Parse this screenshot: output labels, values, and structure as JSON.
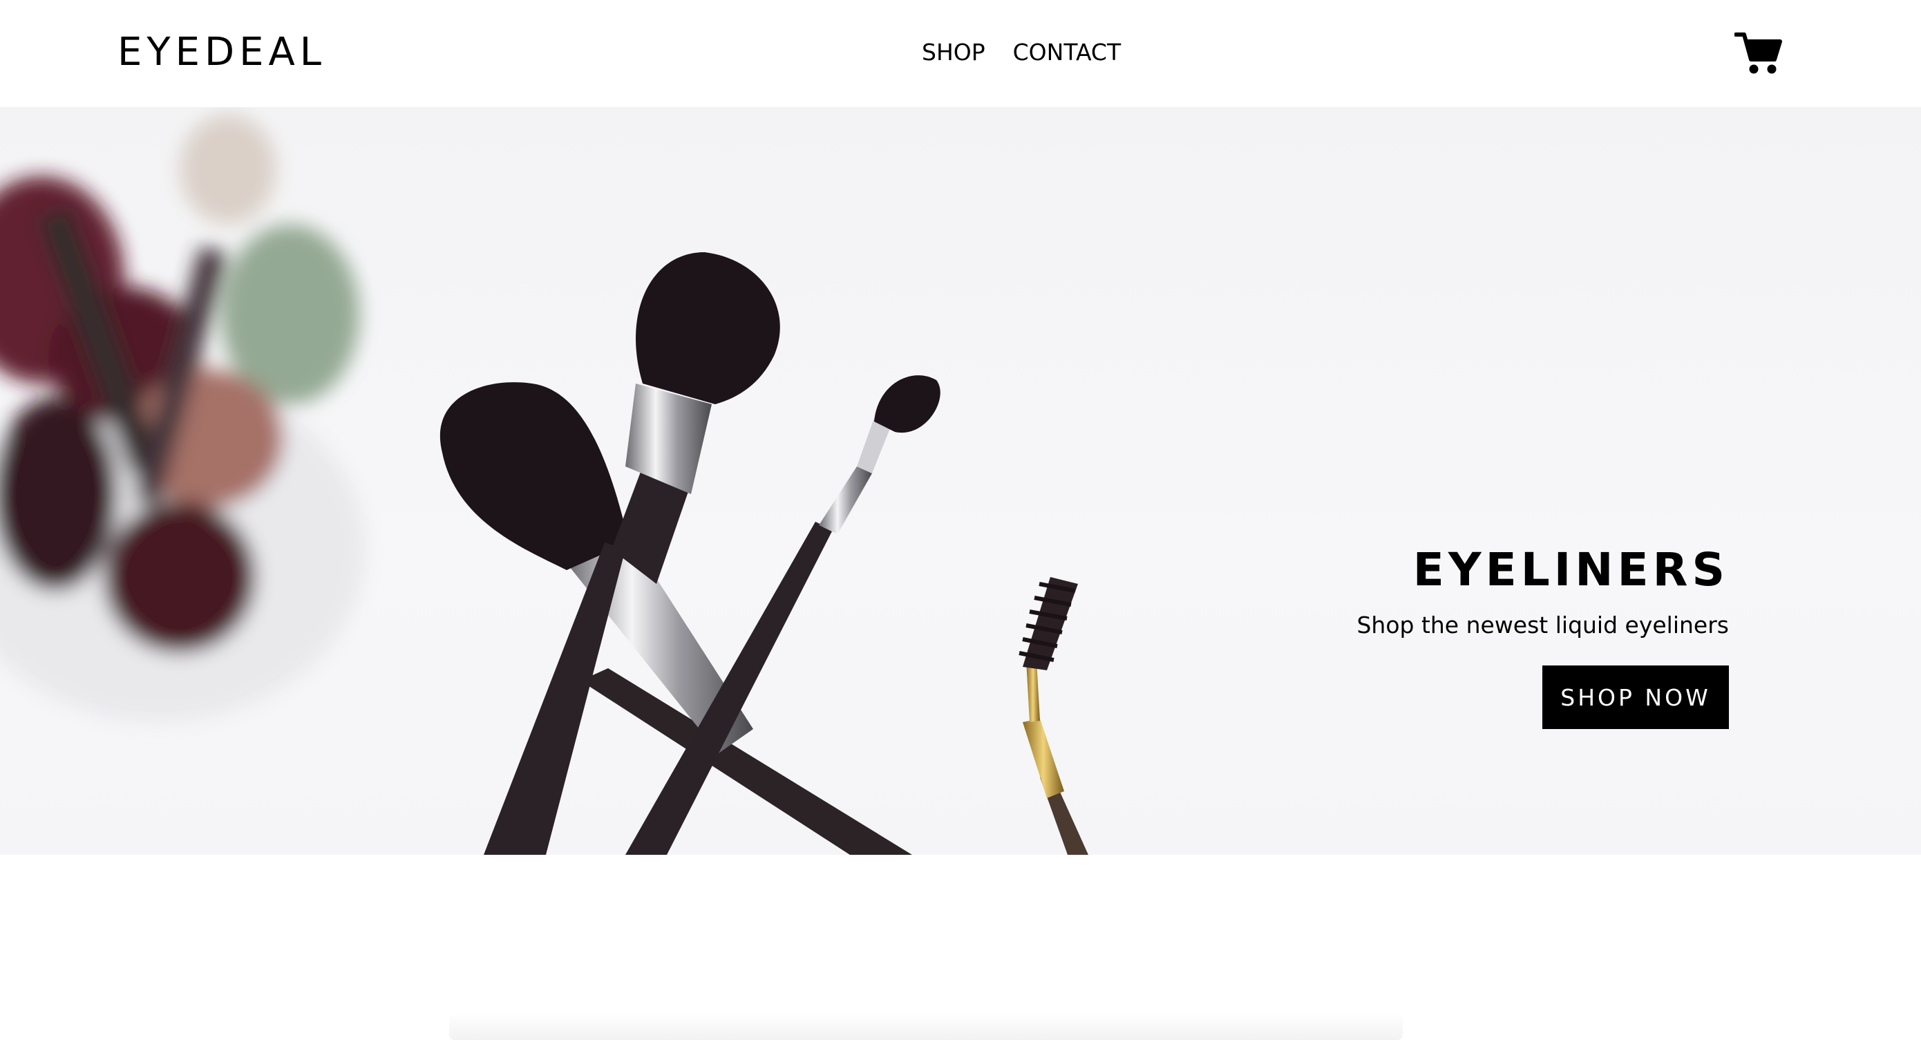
{
  "header": {
    "logo": "EYEDEAL",
    "nav": [
      {
        "label": "SHOP"
      },
      {
        "label": "CONTACT"
      }
    ],
    "cart_icon": "shopping-cart-icon"
  },
  "hero": {
    "title": "EYELINERS",
    "subtitle": "Shop the newest liquid eyeliners",
    "cta_label": "SHOP NOW",
    "image": "makeup-brushes-photo"
  },
  "colors": {
    "text": "#000000",
    "button_bg": "#000000",
    "button_text": "#ffffff",
    "hero_bg": "#f5f5f7"
  }
}
